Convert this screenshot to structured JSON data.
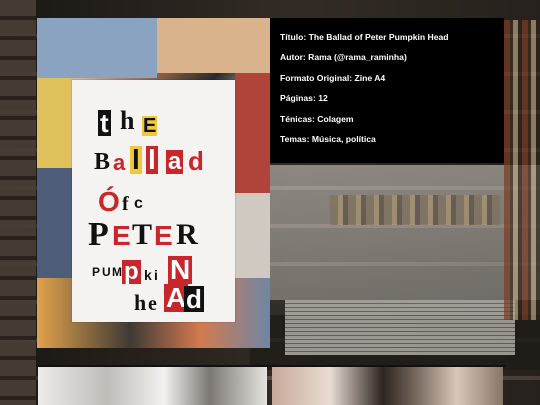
{
  "zine": {
    "cover_letters": {
      "line1": [
        "t",
        "h",
        "E"
      ],
      "line2": [
        "B",
        "a",
        "l",
        "l",
        "a",
        "d"
      ],
      "line3": [
        "Ó",
        "f",
        "c"
      ],
      "line4": [
        "P",
        "E",
        "T",
        "E",
        "R"
      ],
      "line5": [
        "P",
        "U",
        "M",
        "p",
        "k",
        "i",
        "N"
      ],
      "line6": [
        "h",
        "e",
        "A",
        "d"
      ]
    }
  },
  "info": {
    "title": "Título: The Ballad of Peter Pumpkin Head",
    "author": "Autor: Rama (@rama_raminha)",
    "format": "Formato Original: Zine A4",
    "pages": "Páginas: 12",
    "techniques": "Ténicas: Colagem",
    "themes": "Temas: Música, política"
  },
  "colors": {
    "info_bg": "#000000",
    "info_text": "#ffffff",
    "accent_red": "#c8262a",
    "accent_yellow": "#f1c83a"
  }
}
